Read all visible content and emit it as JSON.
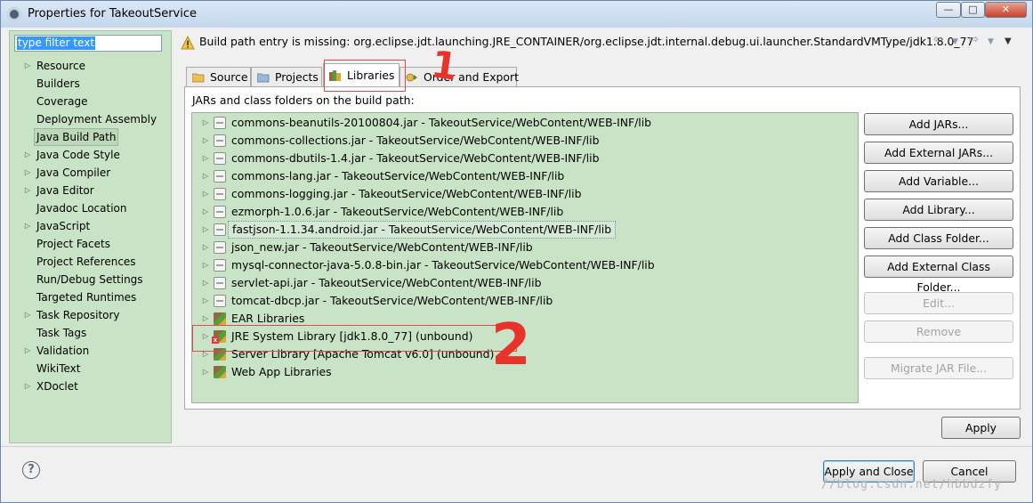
{
  "window": {
    "title": "Properties for TakeoutService",
    "controls": {
      "minimize": "—",
      "maximize": "□",
      "close": "✕"
    }
  },
  "sidebar": {
    "filter_placeholder": "type filter text",
    "items": [
      {
        "label": "Resource",
        "expandable": true
      },
      {
        "label": "Builders",
        "expandable": false
      },
      {
        "label": "Coverage",
        "expandable": false
      },
      {
        "label": "Deployment Assembly",
        "expandable": false
      },
      {
        "label": "Java Build Path",
        "expandable": false,
        "selected": true
      },
      {
        "label": "Java Code Style",
        "expandable": true
      },
      {
        "label": "Java Compiler",
        "expandable": true
      },
      {
        "label": "Java Editor",
        "expandable": true
      },
      {
        "label": "Javadoc Location",
        "expandable": false
      },
      {
        "label": "JavaScript",
        "expandable": true
      },
      {
        "label": "Project Facets",
        "expandable": false
      },
      {
        "label": "Project References",
        "expandable": false
      },
      {
        "label": "Run/Debug Settings",
        "expandable": false
      },
      {
        "label": "Targeted Runtimes",
        "expandable": false
      },
      {
        "label": "Task Repository",
        "expandable": true
      },
      {
        "label": "Task Tags",
        "expandable": false
      },
      {
        "label": "Validation",
        "expandable": true
      },
      {
        "label": "WikiText",
        "expandable": false
      },
      {
        "label": "XDoclet",
        "expandable": true
      }
    ]
  },
  "message": {
    "icon": "warning-icon",
    "text": "Build path entry is missing: org.eclipse.jdt.launching.JRE_CONTAINER/org.eclipse.jdt.internal.debug.ui.launcher.StandardVMType/jdk1.8.0_77"
  },
  "tabs": [
    {
      "label": "Source",
      "icon": "source-folder-icon"
    },
    {
      "label": "Projects",
      "icon": "projects-icon"
    },
    {
      "label": "Libraries",
      "icon": "libraries-icon",
      "active": true
    },
    {
      "label": "Order and Export",
      "icon": "order-export-icon"
    }
  ],
  "libraries": {
    "heading": "JARs and class folders on the build path:",
    "entries": [
      {
        "label": "commons-beanutils-20100804.jar - TakeoutService/WebContent/WEB-INF/lib",
        "kind": "jar"
      },
      {
        "label": "commons-collections.jar - TakeoutService/WebContent/WEB-INF/lib",
        "kind": "jar"
      },
      {
        "label": "commons-dbutils-1.4.jar - TakeoutService/WebContent/WEB-INF/lib",
        "kind": "jar"
      },
      {
        "label": "commons-lang.jar - TakeoutService/WebContent/WEB-INF/lib",
        "kind": "jar"
      },
      {
        "label": "commons-logging.jar - TakeoutService/WebContent/WEB-INF/lib",
        "kind": "jar"
      },
      {
        "label": "ezmorph-1.0.6.jar - TakeoutService/WebContent/WEB-INF/lib",
        "kind": "jar"
      },
      {
        "label": "fastjson-1.1.34.android.jar - TakeoutService/WebContent/WEB-INF/lib",
        "kind": "jar",
        "focused": true
      },
      {
        "label": "json_new.jar - TakeoutService/WebContent/WEB-INF/lib",
        "kind": "jar"
      },
      {
        "label": "mysql-connector-java-5.0.8-bin.jar - TakeoutService/WebContent/WEB-INF/lib",
        "kind": "jar"
      },
      {
        "label": "servlet-api.jar - TakeoutService/WebContent/WEB-INF/lib",
        "kind": "jar"
      },
      {
        "label": "tomcat-dbcp.jar - TakeoutService/WebContent/WEB-INF/lib",
        "kind": "jar"
      },
      {
        "label": "EAR Libraries",
        "kind": "library"
      },
      {
        "label": "JRE System Library [jdk1.8.0_77] (unbound)",
        "kind": "library-error"
      },
      {
        "label": "Server Library [Apache Tomcat v6.0] (unbound)",
        "kind": "library"
      },
      {
        "label": "Web App Libraries",
        "kind": "library"
      }
    ]
  },
  "buttons": {
    "add_jars": "Add JARs...",
    "add_external_jars": "Add External JARs...",
    "add_variable": "Add Variable...",
    "add_library": "Add Library...",
    "add_class_folder": "Add Class Folder...",
    "add_external_class_folder": "Add External Class Folder...",
    "edit": "Edit...",
    "remove": "Remove",
    "migrate_jar": "Migrate JAR File...",
    "apply": "Apply",
    "apply_and_close": "Apply and Close",
    "cancel": "Cancel",
    "help": "?"
  },
  "annotations": {
    "mark_1": "1",
    "mark_2": "2"
  },
  "watermark": "//blog.csdn.net/hbbdzfy",
  "colors": {
    "tree_bg": "#c9e3c6",
    "highlight": "#3399ff",
    "annotation": "#e8332a"
  }
}
